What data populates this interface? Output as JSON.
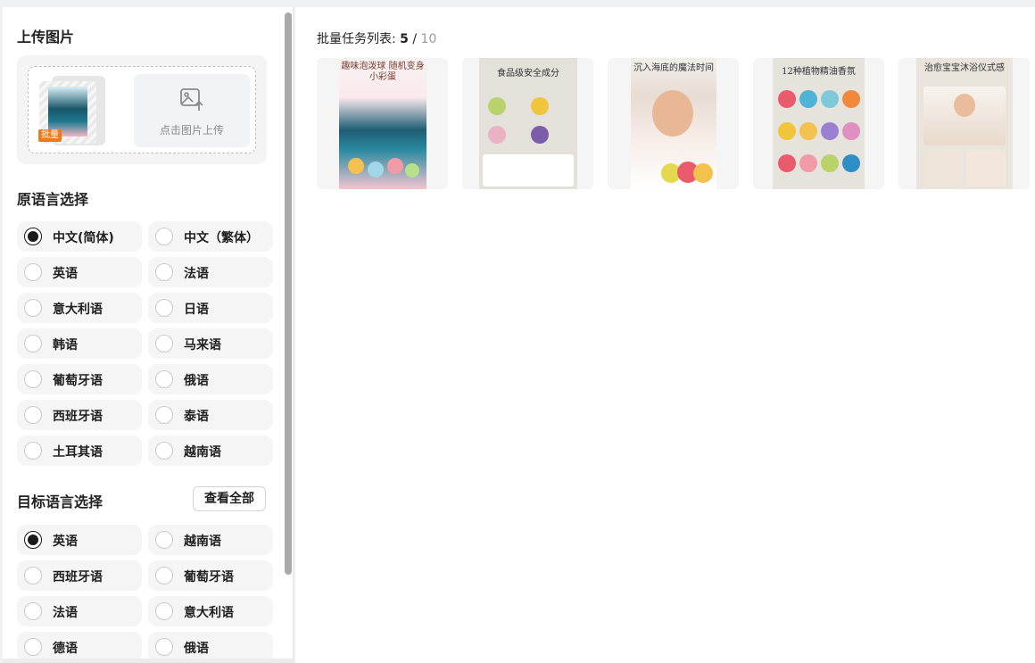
{
  "upload": {
    "title": "上传图片",
    "batch_badge": "批量",
    "upload_label": "点击图片上传",
    "poster_text": "趣味泡泼球\n随机变身小彩蛋"
  },
  "source_lang": {
    "title": "原语言选择",
    "selected": "中文(简体)",
    "options": [
      "中文(简体)",
      "中文（繁体）",
      "英语",
      "法语",
      "意大利语",
      "日语",
      "韩语",
      "马来语",
      "葡萄牙语",
      "俄语",
      "西班牙语",
      "泰语",
      "土耳其语",
      "越南语"
    ]
  },
  "target_lang": {
    "title": "目标语言选择",
    "view_all": "查看全部",
    "selected": "英语",
    "options": [
      "英语",
      "越南语",
      "西班牙语",
      "葡萄牙语",
      "法语",
      "意大利语",
      "德语",
      "俄语"
    ]
  },
  "tasks": {
    "label": "批量任务列表:",
    "count": "5",
    "separator": "/",
    "total": "10",
    "cards": [
      {
        "title": "趣味泡泼球 随机变身小彩蛋",
        "theme": "blue-box"
      },
      {
        "title": "食品级安全成分",
        "theme": "ingredients"
      },
      {
        "title": "沉入海底的魔法时间",
        "theme": "child-bath"
      },
      {
        "title": "12种植物精油香氛",
        "theme": "ball-grid"
      },
      {
        "title": "治愈宝宝沐浴仪式感",
        "theme": "baby-bath"
      }
    ]
  },
  "colors": {
    "accent_dark": "#1a1a1a",
    "badge_orange": "#f07a1a",
    "muted": "#9a9a9a"
  }
}
